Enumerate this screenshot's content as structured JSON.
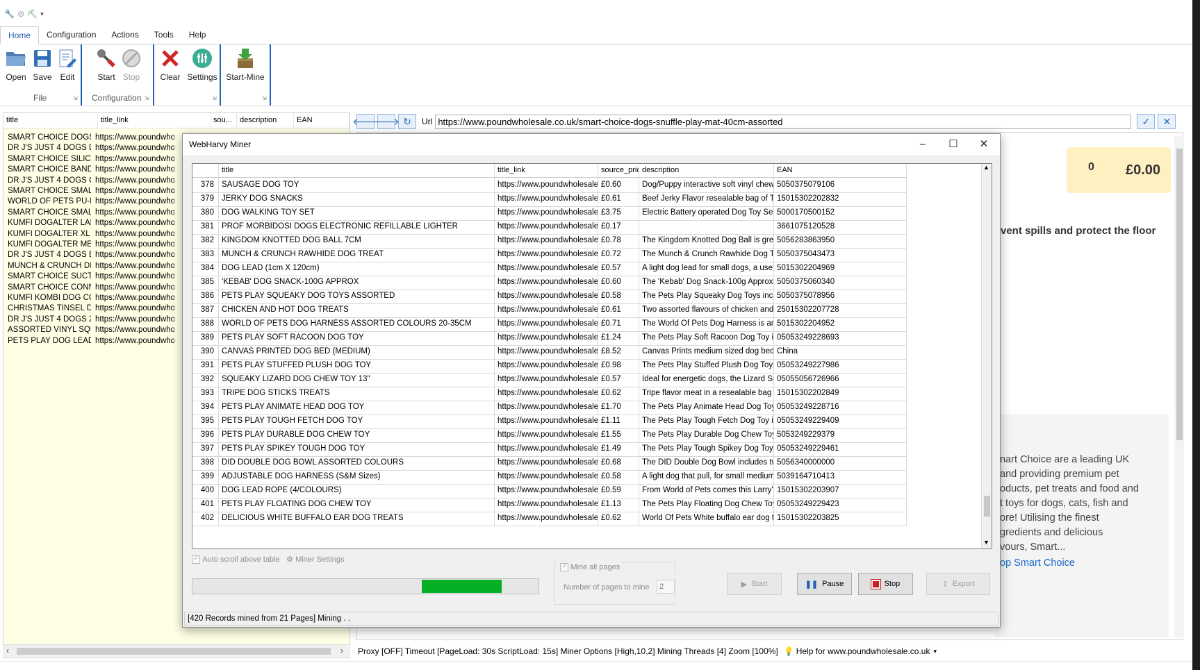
{
  "ribbon": {
    "tabs": [
      "Home",
      "Configuration",
      "Actions",
      "Tools",
      "Help"
    ],
    "buttons": {
      "open": "Open",
      "save": "Save",
      "edit": "Edit",
      "start": "Start",
      "stop": "Stop",
      "clear": "Clear",
      "settings": "Settings",
      "start_mine": "Start-Mine"
    },
    "groups": {
      "file": "File",
      "configuration": "Configuration"
    }
  },
  "left_table": {
    "headers": [
      "title",
      "title_link",
      "sou...",
      "description",
      "EAN"
    ],
    "rows": [
      [
        "SMART CHOICE DOGS ...",
        "https://www.poundwhol"
      ],
      [
        "DR J'S JUST 4 DOGS D...",
        "https://www.poundwhol"
      ],
      [
        "SMART CHOICE SILICO...",
        "https://www.poundwhol"
      ],
      [
        "SMART CHOICE BAND...",
        "https://www.poundwhol"
      ],
      [
        "DR J'S JUST 4 DOGS O...",
        "https://www.poundwhol"
      ],
      [
        "SMART CHOICE SMALL...",
        "https://www.poundwhol"
      ],
      [
        "WORLD OF PETS PU-D...",
        "https://www.poundwhol"
      ],
      [
        "SMART CHOICE SMALL...",
        "https://www.poundwhol"
      ],
      [
        "KUMFI DOGALTER LAR...",
        "https://www.poundwhol"
      ],
      [
        "KUMFI DOGALTER XL",
        "https://www.poundwhol"
      ],
      [
        "KUMFI DOGALTER ME...",
        "https://www.poundwhol"
      ],
      [
        "DR J'S JUST 4 DOGS B...",
        "https://www.poundwhol"
      ],
      [
        "MUNCH & CRUNCH DIN...",
        "https://www.poundwhol"
      ],
      [
        "SMART CHOICE SUCTI...",
        "https://www.poundwhol"
      ],
      [
        "SMART CHOICE CONN...",
        "https://www.poundwhol"
      ],
      [
        "KUMFI KOMBI DOG CO...",
        "https://www.poundwhol"
      ],
      [
        "CHRISTMAS TINSEL D...",
        "https://www.poundwhol"
      ],
      [
        "DR J'S JUST 4 DOGS 2-...",
        "https://www.poundwhol"
      ],
      [
        "ASSORTED VINYL SQU...",
        "https://www.poundwhol"
      ],
      [
        "PETS PLAY DOG LEAD ...",
        "https://www.poundwhol"
      ]
    ]
  },
  "browser": {
    "url_label": "Url",
    "url": "https://www.poundwholesale.co.uk/smart-choice-dogs-snuffle-play-mat-40cm-assorted",
    "cart_count": "0",
    "cart_total": "£0.00",
    "text1": "vent spills and protect the floor",
    "panel_lines": [
      "nart Choice are a leading UK",
      "and providing premium pet",
      "oducts, pet treats and food and",
      "t toys for dogs, cats, fish and",
      "ore! Utilising the finest",
      "gredients and delicious",
      "vours, Smart..."
    ],
    "panel_link": "op Smart Choice"
  },
  "status_bar": "Proxy [OFF] Timeout [PageLoad: 30s ScriptLoad: 15s] Miner Options [High,10,2] Mining Threads [4] Zoom [100%]",
  "help_link": "Help for www.poundwholesale.co.uk",
  "dialog": {
    "title": "WebHarvy Miner",
    "headers": [
      "",
      "title",
      "title_link",
      "source_price",
      "description",
      "EAN"
    ],
    "rows": [
      [
        "378",
        "SAUSAGE DOG TOY",
        "https://www.poundwholesale....",
        "£0.60",
        "Dog/Puppy interactive soft vinyl chew to...",
        "5050375079106"
      ],
      [
        "379",
        "JERKY DOG SNACKS",
        "https://www.poundwholesale....",
        "£0.61",
        "Beef Jerky Flavor resealable bag of Tasty...",
        "15015302202832"
      ],
      [
        "380",
        "DOG WALKING TOY SET",
        "https://www.poundwholesale....",
        "£3.75",
        "Electric Battery operated Dog Toy SetDo...",
        "5000170500152"
      ],
      [
        "381",
        "PROF MORBIDOSI DOGS ELECTRONIC REFILLABLE LIGHTER",
        "https://www.poundwholesale....",
        "£0.17",
        "",
        "3661075120528"
      ],
      [
        "382",
        "KINGDOM KNOTTED DOG BALL 7CM",
        "https://www.poundwholesale....",
        "£0.78",
        "The Kingdom Knotted Dog Ball is great fu...",
        "5056283863950"
      ],
      [
        "383",
        "MUNCH & CRUNCH RAWHIDE DOG TREAT",
        "https://www.poundwholesale....",
        "£0.72",
        "The Munch & Crunch Rawhide Dog Trea...",
        "5050375043473"
      ],
      [
        "384",
        "DOG LEAD (1cm X 120cm)",
        "https://www.poundwholesale....",
        "£0.57",
        "A light dog lead for small dogs, a useful a...",
        "5015302204969"
      ],
      [
        "385",
        "'KEBAB' DOG SNACK-100G APPROX",
        "https://www.poundwholesale....",
        "£0.60",
        "The 'Kebab' Dog Snack-100g Approx is a...",
        "5050375060340"
      ],
      [
        "386",
        "PETS PLAY SQUEAKY DOG TOYS ASSORTED",
        "https://www.poundwholesale....",
        "£0.58",
        "The Pets Play Squeaky Dog Toys includ...",
        "5050375078956"
      ],
      [
        "387",
        "CHICKEN AND HOT DOG TREATS",
        "https://www.poundwholesale....",
        "£0.61",
        "Two assorted flavours of chicken and be...",
        "25015302207728"
      ],
      [
        "388",
        "WORLD OF PETS DOG HARNESS ASSORTED COLOURS 20-35CM",
        "https://www.poundwholesale....",
        "£0.71",
        "The World Of Pets Dog Harness is an ex...",
        "5015302204952"
      ],
      [
        "389",
        "PETS PLAY SOFT RACOON DOG TOY",
        "https://www.poundwholesale....",
        "£1.24",
        "The Pets Play Soft Racoon Dog Toy is a ...",
        "05053249228693"
      ],
      [
        "390",
        "CANVAS PRINTED DOG BED (MEDIUM)",
        "https://www.poundwholesale....",
        "£8.52",
        "Canvas Prints medium sized dog bed.Sw...",
        "China"
      ],
      [
        "391",
        "PETS PLAY STUFFED PLUSH DOG TOY",
        "https://www.poundwholesale....",
        "£0.98",
        "The Pets Play Stuffed Plush Dog Toys ar...",
        "05053249227986"
      ],
      [
        "392",
        "SQUEAKY LIZARD DOG CHEW TOY 13\"",
        "https://www.poundwholesale....",
        "£0.57",
        "Ideal for energetic dogs, the Lizard Sque...",
        "05055056726966"
      ],
      [
        "393",
        "TRIPE DOG STICKS TREATS",
        "https://www.poundwholesale....",
        "£0.62",
        "Tripe flavor meat in a resealable bag of T...",
        "15015302202849"
      ],
      [
        "394",
        "PETS PLAY ANIMATE HEAD DOG TOY",
        "https://www.poundwholesale....",
        "£1.70",
        "The Pets Play Animate Head Dog Toy is ...",
        "05053249228716"
      ],
      [
        "395",
        "PETS PLAY TOUGH FETCH DOG TOY",
        "https://www.poundwholesale....",
        "£1.11",
        "The Pets Play Tough Fetch Dog Toy is a ...",
        "05053249229409"
      ],
      [
        "396",
        "PETS PLAY DURABLE DOG CHEW TOY",
        "https://www.poundwholesale....",
        "£1.55",
        "The Pets Play Durable Dog Chew Toy is t...",
        "5053249229379"
      ],
      [
        "397",
        "PETS PLAY SPIKEY TOUGH DOG TOY",
        "https://www.poundwholesale....",
        "£1.49",
        "The Pets Play Tough Spikey Dog Toy is ...",
        "05053249229461"
      ],
      [
        "398",
        "DID DOUBLE DOG BOWL ASSORTED COLOURS",
        "https://www.poundwholesale....",
        "£0.68",
        "The DID Double Dog Bowl includes two ...",
        "5056340000000"
      ],
      [
        "399",
        "ADJUSTABLE DOG HARNESS (S&M Sizes)",
        "https://www.poundwholesale....",
        "£0.58",
        "A light dog that pull, for small medium size...",
        "5039164710413"
      ],
      [
        "400",
        "DOG LEAD ROPE (4/COLOURS)",
        "https://www.poundwholesale....",
        "£0.59",
        "From World of Pets comes this Larry's Le...",
        "15015302203907"
      ],
      [
        "401",
        "PETS PLAY FLOATING DOG CHEW TOY",
        "https://www.poundwholesale....",
        "£1.13",
        "The Pets Play Floating Dog Chew Toy is ...",
        "05053249229423"
      ],
      [
        "402",
        "DELICIOUS WHITE BUFFALO EAR DOG TREATS",
        "https://www.poundwholesale....",
        "£0.62",
        "World Of Pets White buffalo ear dog treat...",
        "15015302203825"
      ]
    ],
    "auto_scroll_label": "Auto scroll above table",
    "miner_settings_label": "Miner Settings",
    "progress_fraction": 0.65,
    "mine_all_pages_label": "Mine all pages",
    "pages_label": "Number of pages to mine",
    "pages_value": "2",
    "buttons": {
      "start": "Start",
      "pause": "Pause",
      "stop": "Stop",
      "export": "Export"
    },
    "status": "[420 Records mined from 21 Pages]  Mining . ."
  }
}
